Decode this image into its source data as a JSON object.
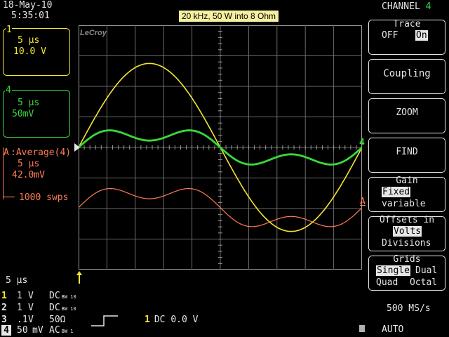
{
  "header": {
    "date": "18-May-10",
    "time": "5:35:01",
    "title": "20 kHz, 50 W into 8 Ohm",
    "brand": "LeCroy"
  },
  "channel_boxes": [
    {
      "marker": "1",
      "timebase": "5 µs",
      "scale": "10.0 V",
      "color": "#f5e633"
    },
    {
      "marker": "4",
      "timebase": "5 µs",
      "scale": "50mV",
      "color": "#39d93b"
    },
    {
      "marker": "A",
      "label": ":Average(4)",
      "timebase": "5 µs",
      "scale": "42.0mV",
      "sweeps": "1000 swps",
      "color": "#ff7b55"
    }
  ],
  "right_menu": {
    "header": "CHANNEL",
    "channel_number": "4",
    "trace": {
      "title": "Trace",
      "off": "OFF",
      "on": "On"
    },
    "coupling": "Coupling",
    "zoom": "ZOOM",
    "find": "FIND",
    "gain": {
      "title": "Gain",
      "fixed": "Fixed",
      "variable": "variable"
    },
    "offsets": {
      "title": "Offsets in",
      "volts": "Volts",
      "divisions": "Divisions"
    },
    "grids": {
      "title": "Grids",
      "single": "Single",
      "dual": "Dual",
      "quad": "Quad",
      "octal": "Octal"
    }
  },
  "bottom": {
    "timebase": "5 µs",
    "channels": [
      {
        "num": "1",
        "volts": "1",
        "unit": "V",
        "coupling": "DC",
        "bw": "BW 10"
      },
      {
        "num": "2",
        "volts": "1",
        "unit": "V",
        "coupling": "DC",
        "bw": "BW 10"
      },
      {
        "num": "3",
        "volts": ".1",
        "unit": "V",
        "coupling": "50Ω",
        "bw": ""
      },
      {
        "num": "4",
        "volts": "50",
        "unit": "mV",
        "coupling": "AC",
        "bw": "BW 1"
      }
    ],
    "trigger": {
      "source": "1",
      "coupling": "DC",
      "level": "0.0 V"
    },
    "sample_rate": "500 MS/s",
    "trigger_mode": "AUTO"
  },
  "waveforms": {
    "yellow_sine": {
      "color": "#f5e633",
      "cycles": 1,
      "amplitude_div": 2.75
    },
    "green_distorted": {
      "color": "#39d93b",
      "fundamental_cycles": 1,
      "harmonic": 3
    },
    "orange_average": {
      "color": "#ff7b55",
      "fundamental_cycles": 1,
      "harmonic": 3
    }
  }
}
